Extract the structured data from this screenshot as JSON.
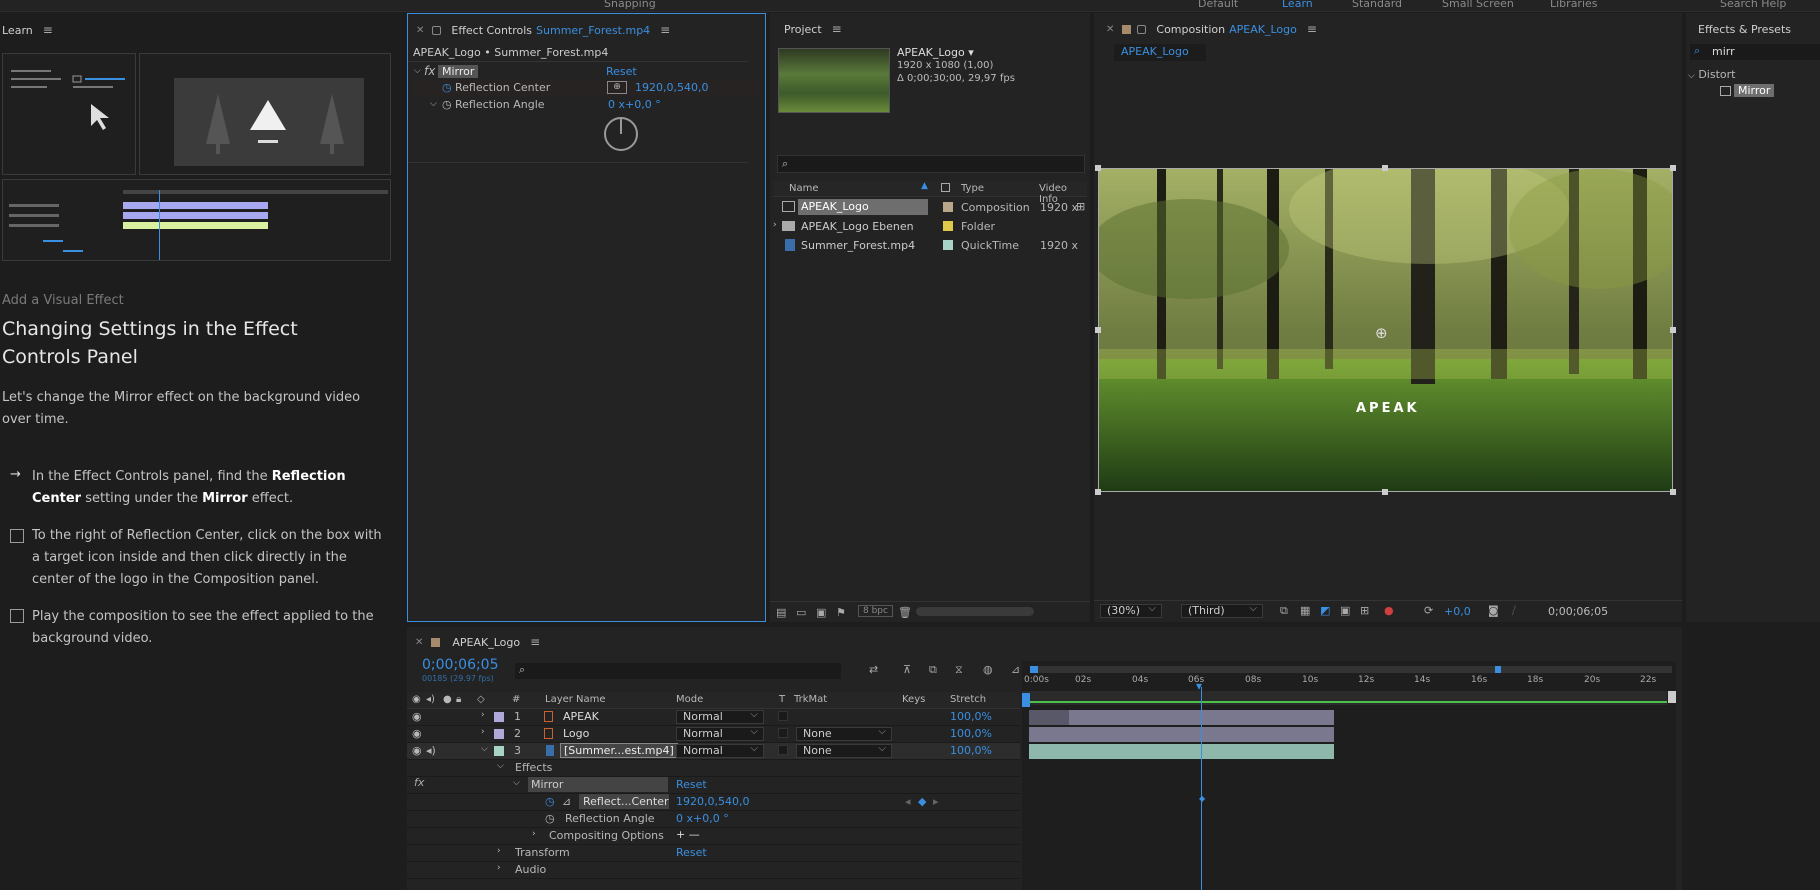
{
  "workspaces": {
    "default": "Default",
    "learn": "Learn",
    "standard": "Standard",
    "small_screen": "Small Screen",
    "libraries": "Libraries",
    "snapping": "Snapping",
    "search_help": "Search Help"
  },
  "learn": {
    "tab": "Learn",
    "sub": "Add a Visual Effect",
    "title": "Changing Settings in the Effect Controls Panel",
    "intro": "Let's change the Mirror effect on the background video over time.",
    "step1_a": "In the Effect Controls panel, find the ",
    "step1_b": "Reflection Center",
    "step1_c": " setting under the ",
    "step1_d": "Mirror",
    "step1_e": " effect.",
    "step2": "To the right of Reflection Center, click on the box with a target icon inside and then click directly in the center of the logo in the Composition panel.",
    "step3": "Play the composition to see the effect applied to the background video."
  },
  "effect_controls": {
    "tab": "Effect Controls",
    "tab_file": "Summer_Forest.mp4",
    "breadcrumb": "APEAK_Logo • Summer_Forest.mp4",
    "effect_name": "Mirror",
    "reset": "Reset",
    "prop1_label": "Reflection Center",
    "prop1_value": "1920,0,540,0",
    "prop2_label": "Reflection Angle",
    "prop2_value": "0 x+0,0 °"
  },
  "project": {
    "tab": "Project",
    "comp_name": "APEAK_Logo ▾",
    "comp_info1": "1920 x 1080 (1,00)",
    "comp_info2": "Δ 0;00;30;00, 29,97 fps",
    "search_placeholder": "",
    "col_name": "Name",
    "col_type": "Type",
    "col_video": "Video Info",
    "items": [
      {
        "name": "APEAK_Logo",
        "type": "Composition",
        "info": "1920 x",
        "color": "#b8a58a"
      },
      {
        "name": "APEAK_Logo Ebenen",
        "type": "Folder",
        "info": "",
        "color": "#e0c94a"
      },
      {
        "name": "Summer_Forest.mp4",
        "type": "QuickTime",
        "info": "1920 x",
        "color": "#a8d4c8"
      }
    ],
    "bpc": "8 bpc"
  },
  "composition": {
    "tab": "Composition",
    "tab_name": "APEAK_Logo",
    "subtab": "APEAK_Logo",
    "logo_text": "APEAK",
    "zoom": "(30%)",
    "resolution": "(Third)",
    "exposure": "+0,0",
    "timecode": "0;00;06;05"
  },
  "effects_presets": {
    "tab": "Effects & Presets",
    "search": "mirr",
    "category": "Distort",
    "item": "Mirror"
  },
  "timeline": {
    "tab": "APEAK_Logo",
    "timecode": "0;00;06;05",
    "frames": "00185 (29.97 fps)",
    "col_num": "#",
    "col_layer": "Layer Name",
    "col_mode": "Mode",
    "col_t": "T",
    "col_trkmat": "TrkMat",
    "col_keys": "Keys",
    "col_stretch": "Stretch",
    "layers": [
      {
        "num": "1",
        "name": "APEAK",
        "mode": "Normal",
        "trkmat": "",
        "stretch": "100,0%",
        "color": "#b0a8d8"
      },
      {
        "num": "2",
        "name": "Logo",
        "mode": "Normal",
        "trkmat": "None",
        "stretch": "100,0%",
        "color": "#b0a8d8"
      },
      {
        "num": "3",
        "name": "[Summer...est.mp4]",
        "mode": "Normal",
        "trkmat": "None",
        "stretch": "100,0%",
        "color": "#a8d4c8"
      }
    ],
    "effects_label": "Effects",
    "mirror_label": "Mirror",
    "reset": "Reset",
    "reflect_center_label": "Reflect...Center",
    "reflect_center_value": "1920,0,540,0",
    "reflect_angle_label": "Reflection Angle",
    "reflect_angle_value": "0 x+0,0 °",
    "compositing_label": "Compositing Options",
    "compositing_value": "+ —",
    "transform_label": "Transform",
    "audio_label": "Audio",
    "ruler": [
      "0:00s",
      "02s",
      "04s",
      "06s",
      "08s",
      "10s",
      "12s",
      "14s",
      "16s",
      "18s",
      "20s",
      "22s"
    ]
  }
}
